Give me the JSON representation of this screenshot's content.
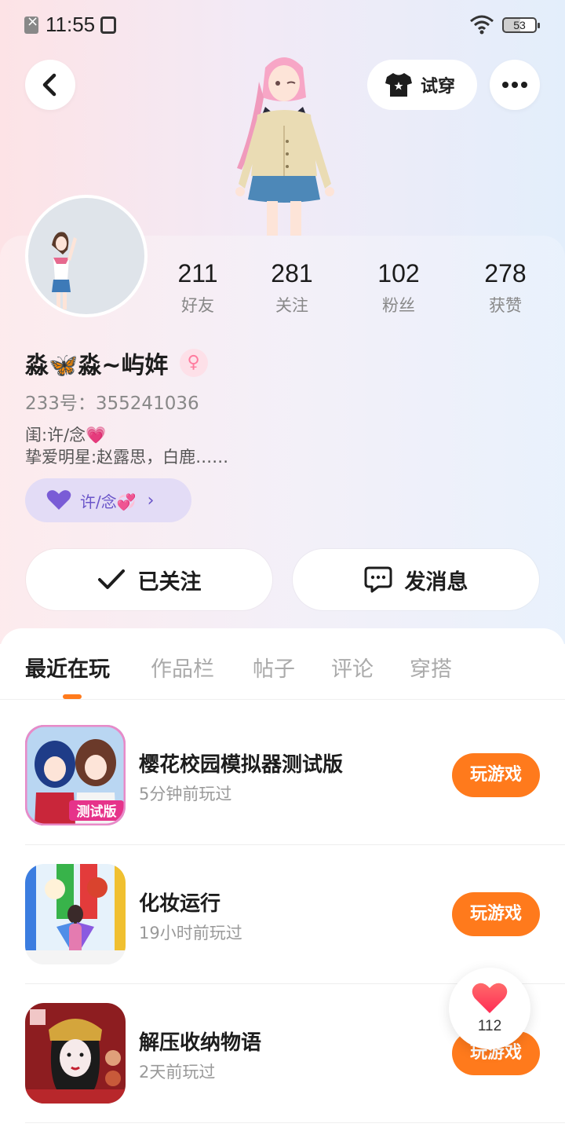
{
  "status_bar": {
    "time": "11:55",
    "battery": "53"
  },
  "header": {
    "try_on_label": "试穿"
  },
  "profile": {
    "stats": [
      {
        "value": "211",
        "label": "好友"
      },
      {
        "value": "281",
        "label": "关注"
      },
      {
        "value": "102",
        "label": "粉丝"
      },
      {
        "value": "278",
        "label": "获赞"
      }
    ],
    "name": "淼🦋淼~屿姩",
    "gender_symbol": "♀",
    "uid": "233号：355241036",
    "bio_line1": "闺:许/念💗",
    "bio_line2": "挚爱明星:赵露思，白鹿……",
    "tag_label": "许/念💞"
  },
  "actions": {
    "follow_label": "已关注",
    "message_label": "发消息"
  },
  "tabs": [
    {
      "label": "最近在玩",
      "active": true
    },
    {
      "label": "作品栏",
      "active": false
    },
    {
      "label": "帖子",
      "active": false
    },
    {
      "label": "评论",
      "active": false
    },
    {
      "label": "穿搭",
      "active": false
    }
  ],
  "games": [
    {
      "title": "樱花校园模拟器测试版",
      "played": "5分钟前玩过",
      "play_label": "玩游戏",
      "icon_badge": "测试版"
    },
    {
      "title": "化妆运行",
      "played": "19小时前玩过",
      "play_label": "玩游戏"
    },
    {
      "title": "解压收纳物语",
      "played": "2天前玩过",
      "play_label": "玩游戏"
    }
  ],
  "floating_like": {
    "count": "112"
  },
  "colors": {
    "accent": "#ff7a1c",
    "tag_bg": "#e3dcf6",
    "tag_text": "#6a55c9"
  }
}
